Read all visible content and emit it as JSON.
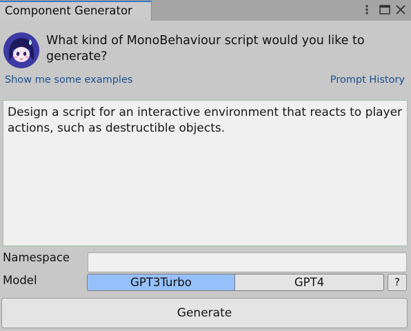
{
  "window": {
    "tab_title": "Component Generator",
    "icons": [
      "kebab-menu-icon",
      "maximize-icon",
      "close-icon"
    ]
  },
  "header": {
    "question": "What kind of MonoBehaviour script would you like to generate?"
  },
  "links": {
    "examples": "Show me some examples",
    "history": "Prompt History"
  },
  "prompt": {
    "value": "Design a script for an interactive environment that reacts to player actions, such as destructible objects."
  },
  "form": {
    "namespace_label": "Namespace",
    "namespace_value": "",
    "model_label": "Model",
    "model_options": [
      "GPT3Turbo",
      "GPT4"
    ],
    "model_selected": "GPT3Turbo",
    "help_label": "?"
  },
  "actions": {
    "generate_label": "Generate"
  },
  "colors": {
    "tab_accent": "#3a79bb",
    "selected_segment": "#96c0fa",
    "link": "#1b4f8d",
    "avatar_bg": "#3d3aa3"
  }
}
